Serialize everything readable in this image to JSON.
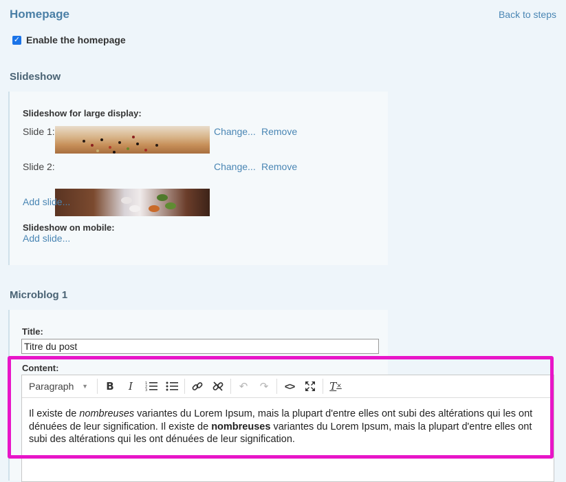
{
  "header": {
    "title": "Homepage",
    "back_link": "Back to steps"
  },
  "enable": {
    "label": "Enable the homepage",
    "checked": true
  },
  "slideshow": {
    "section_title": "Slideshow",
    "large_label": "Slideshow for large display:",
    "slides": [
      {
        "label": "Slide 1:",
        "change": "Change...",
        "remove": "Remove"
      },
      {
        "label": "Slide 2:",
        "change": "Change...",
        "remove": "Remove"
      }
    ],
    "add_slide": "Add slide...",
    "mobile_label": "Slideshow on mobile:",
    "mobile_add_slide": "Add slide..."
  },
  "microblog": {
    "section_title": "Microblog 1",
    "title_label": "Title:",
    "title_value": "Titre du post",
    "content_label": "Content:",
    "toolbar": {
      "format_select": "Paragraph",
      "buttons": [
        "bold-icon",
        "italic-icon",
        "numbered-list-icon",
        "bullet-list-icon",
        "link-icon",
        "unlink-icon",
        "undo-icon",
        "redo-icon",
        "source-code-icon",
        "fullscreen-icon",
        "clear-format-icon"
      ]
    },
    "content": {
      "p1": "Il existe de ",
      "p1_em": "nombreuses",
      "p2": " variantes du Lorem Ipsum, mais la plupart d'entre elles ont subi des altérations qui les ont dénuées de leur signification. Il existe de ",
      "p2_strong": "nombreuses",
      "p3": " variantes du Lorem Ipsum, mais la plupart d'entre elles ont subi des altérations qui les ont dénuées de leur signification."
    }
  },
  "colors": {
    "accent": "#4a86b4",
    "highlight": "#e815c8",
    "background": "#eef5fa"
  }
}
